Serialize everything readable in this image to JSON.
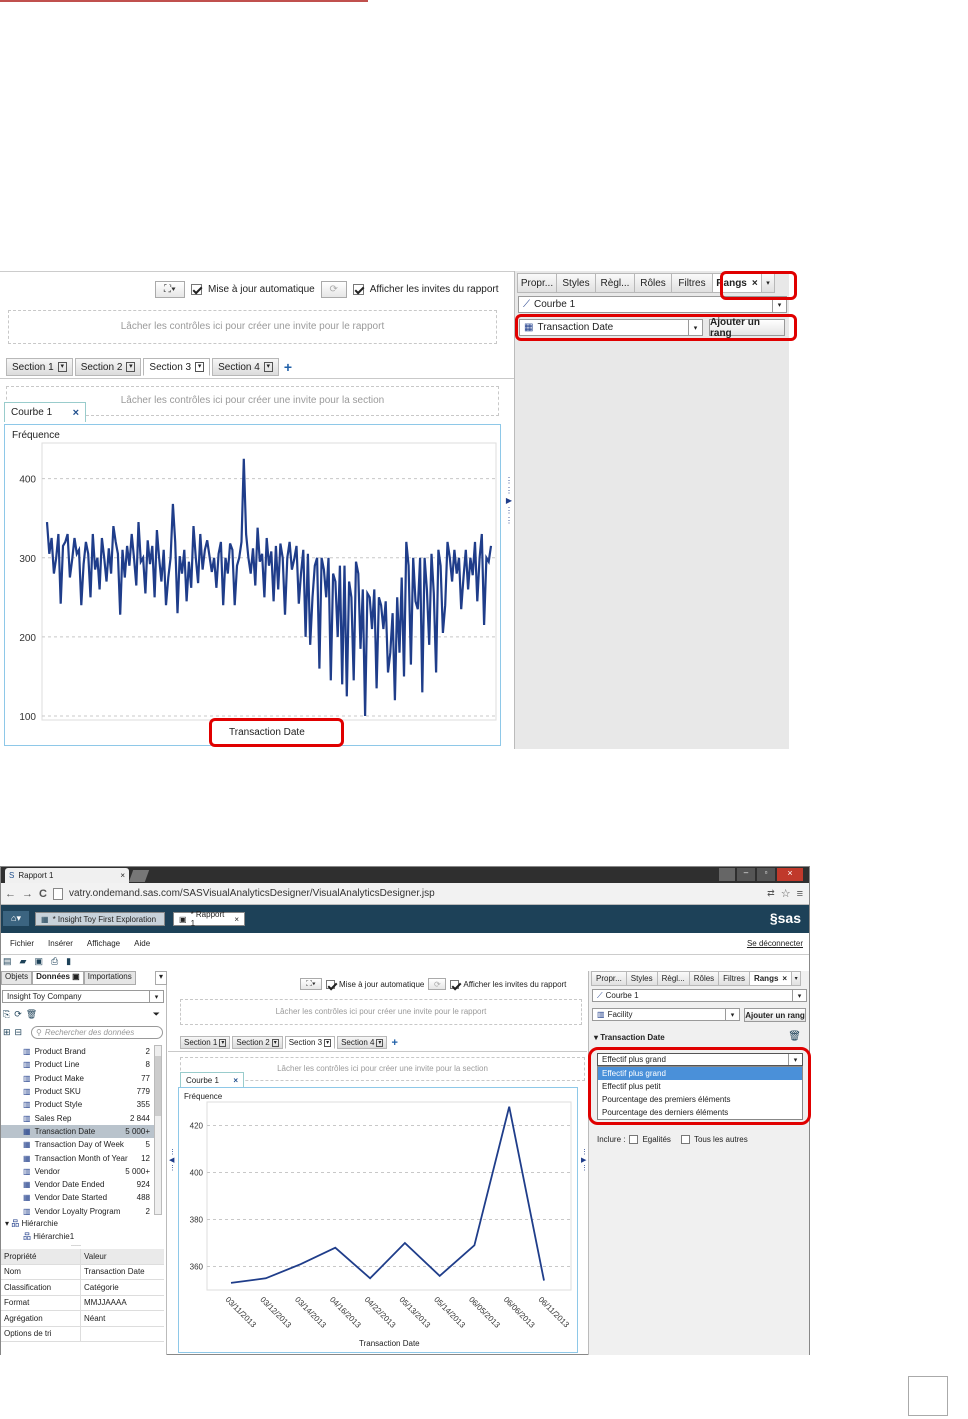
{
  "top": {
    "toolbar": {
      "auto_update": "Mise à jour automatique",
      "show_prompts": "Afficher les invites du rapport"
    },
    "report_drop": "Lâcher les contrôles ici pour créer une invite pour le rapport",
    "section_drop": "Lâcher les contrôles ici pour créer une invite pour la section",
    "sections": [
      "Section 1",
      "Section 2",
      "Section 3",
      "Section 4"
    ],
    "object_tab": "Courbe 1",
    "chart_title": "Fréquence",
    "xlabel": "Transaction Date",
    "yticks": [
      "400",
      "300",
      "200",
      "100"
    ],
    "right_tabs": [
      "Propr...",
      "Styles",
      "Règl...",
      "Rôles",
      "Filtres",
      "Rangs"
    ],
    "object_select": "Courbe 1",
    "field_select": "Transaction Date",
    "add_rank": "Ajouter un rang"
  },
  "bottom": {
    "browser": {
      "tab": "Rapport 1",
      "url": "vatry.ondemand.sas.com/SASVisualAnalyticsDesigner/VisualAnalyticsDesigner.jsp"
    },
    "app_tabs": [
      "* Insight Toy First Exploration",
      "* Rapport 1"
    ],
    "brand": "sas",
    "menu": [
      "Fichier",
      "Insérer",
      "Affichage",
      "Aide"
    ],
    "logout": "Se déconnecter",
    "left_tabs": [
      "Objets",
      "Données",
      "Importations"
    ],
    "datasource": "Insight Toy Company",
    "search_placeholder": "Rechercher des données",
    "data_items": [
      {
        "name": "Product Brand",
        "count": "2"
      },
      {
        "name": "Product Line",
        "count": "8"
      },
      {
        "name": "Product Make",
        "count": "77"
      },
      {
        "name": "Product SKU",
        "count": "779"
      },
      {
        "name": "Product Style",
        "count": "355"
      },
      {
        "name": "Sales Rep",
        "count": "2 844"
      },
      {
        "name": "Transaction Date",
        "count": "5 000+"
      },
      {
        "name": "Transaction Day of Week",
        "count": "5"
      },
      {
        "name": "Transaction Month of Year",
        "count": "12"
      },
      {
        "name": "Vendor",
        "count": "5 000+"
      },
      {
        "name": "Vendor Date Ended",
        "count": "924"
      },
      {
        "name": "Vendor Date Started",
        "count": "488"
      },
      {
        "name": "Vendor Loyalty Program",
        "count": "2"
      }
    ],
    "hierarchy_label": "Hiérarchie",
    "hierarchy_item": "Hiérarchie1",
    "props_headers": [
      "Propriété",
      "Valeur"
    ],
    "props": [
      [
        "Nom",
        "Transaction Date"
      ],
      [
        "Classification",
        "Catégorie"
      ],
      [
        "Format",
        "MMJJAAAA"
      ],
      [
        "Agrégation",
        "Néant"
      ],
      [
        "Options de tri",
        ""
      ]
    ],
    "toolbar": {
      "auto_update": "Mise à jour automatique",
      "show_prompts": "Afficher les invites du rapport"
    },
    "report_drop": "Lâcher les contrôles ici pour créer une invite pour le rapport",
    "section_drop": "Lâcher les contrôles ici pour créer une invite pour la section",
    "sections": [
      "Section 1",
      "Section 2",
      "Section 3",
      "Section 4"
    ],
    "object_tab": "Courbe 1",
    "chart_title": "Fréquence",
    "xlabel": "Transaction Date",
    "yticks": [
      "420",
      "400",
      "380",
      "360"
    ],
    "xticks": [
      "03/11/2013",
      "03/12/2013",
      "03/14/2013",
      "04/16/2013",
      "04/22/2013",
      "05/13/2013",
      "05/14/2013",
      "06/05/2013",
      "06/06/2013",
      "06/11/2013"
    ],
    "right_tabs": [
      "Propr...",
      "Styles",
      "Règl...",
      "Rôles",
      "Filtres",
      "Rangs"
    ],
    "object_select": "Courbe 1",
    "field_select": "Facility",
    "add_rank": "Ajouter un rang",
    "rank_header": "Transaction Date",
    "rank_select": "Effectif plus grand",
    "rank_options": [
      "Effectif plus grand",
      "Effectif plus petit",
      "Pourcentage des premiers éléments",
      "Pourcentage des derniers éléments"
    ],
    "include_label": "Inclure :",
    "ties": "Egalités",
    "all_others": "Tous les autres"
  },
  "chart_data": [
    {
      "type": "line",
      "title": "Fréquence",
      "xlabel": "Transaction Date",
      "ylabel": "Fréquence",
      "ylim": [
        95,
        445
      ],
      "grid": true,
      "values": [
        345,
        305,
        325,
        280,
        300,
        330,
        242,
        315,
        320,
        330,
        275,
        298,
        325,
        305,
        310,
        240,
        292,
        320,
        305,
        250,
        330,
        285,
        300,
        260,
        325,
        300,
        270,
        312,
        280,
        340,
        320,
        305,
        228,
        310,
        275,
        315,
        290,
        330,
        300,
        265,
        345,
        295,
        300,
        255,
        322,
        292,
        315,
        250,
        335,
        300,
        270,
        310,
        240,
        275,
        300,
        368,
        320,
        230,
        302,
        280,
        310,
        245,
        295,
        262,
        340,
        300,
        268,
        330,
        285,
        310,
        322,
        302,
        282,
        300,
        262,
        305,
        320,
        240,
        300,
        280,
        318,
        310,
        240,
        290,
        300,
        320,
        425,
        330,
        300,
        280,
        312,
        265,
        338,
        295,
        305,
        250,
        325,
        290,
        308,
        245,
        315,
        260,
        318,
        300,
        228,
        300,
        320,
        285,
        298,
        315,
        242,
        280,
        310,
        200,
        305,
        190,
        250,
        290,
        300,
        160,
        300,
        285,
        250,
        300,
        145,
        280,
        270,
        200,
        290,
        140,
        290,
        125,
        270,
        250,
        145,
        295,
        280,
        185,
        260,
        100,
        255,
        250,
        210,
        260,
        135,
        250,
        240,
        210,
        245,
        155,
        180,
        230,
        120,
        250,
        180,
        275,
        150,
        320,
        290,
        165,
        300,
        245,
        235,
        300,
        130,
        300,
        260,
        190,
        305,
        255,
        155,
        310,
        290,
        205,
        240,
        320,
        300,
        270,
        310,
        280,
        300,
        235,
        275,
        310,
        260,
        300,
        278,
        320,
        245,
        300,
        330,
        215,
        300,
        295,
        315
      ]
    },
    {
      "type": "line",
      "title": "Fréquence",
      "xlabel": "Transaction Date",
      "ylabel": "Fréquence",
      "ylim": [
        350,
        430
      ],
      "grid": true,
      "x": [
        "03/11/2013",
        "03/12/2013",
        "03/14/2013",
        "04/16/2013",
        "04/22/2013",
        "05/13/2013",
        "05/14/2013",
        "06/05/2013",
        "06/06/2013",
        "06/11/2013"
      ],
      "values": [
        353,
        355,
        361,
        368,
        355,
        370,
        356,
        369,
        428,
        354
      ]
    }
  ]
}
